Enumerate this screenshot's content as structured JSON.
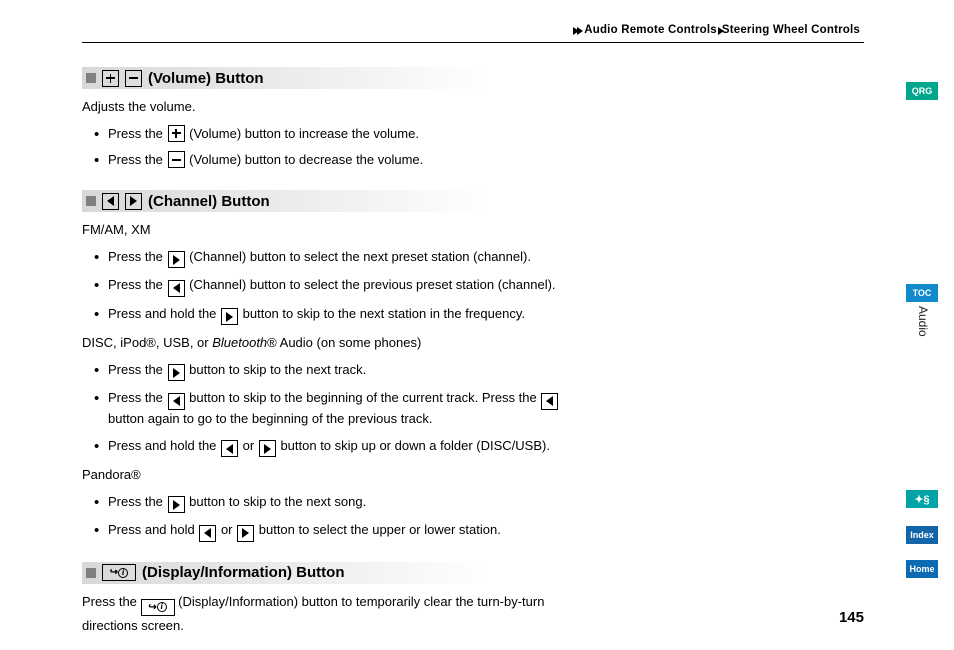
{
  "breadcrumb": {
    "a": "Audio Remote Controls",
    "b": "Steering Wheel Controls"
  },
  "sec1": {
    "title": "(Volume) Button",
    "intro": "Adjusts the volume.",
    "li1a": "Press the ",
    "li1b": " (Volume) button to increase the volume.",
    "li2a": "Press the ",
    "li2b": " (Volume) button to decrease the volume."
  },
  "sec2": {
    "title": "(Channel) Button",
    "sub1": "FM/AM, XM",
    "a1a": "Press the ",
    "a1b": " (Channel) button to select the next preset station (channel).",
    "a2a": "Press the ",
    "a2b": " (Channel) button to select the previous preset station (channel).",
    "a3a": "Press and hold the ",
    "a3b": " button to skip to the next station in the frequency.",
    "sub2a": "DISC, iPod®, USB, or ",
    "sub2b": "Bluetooth",
    "sub2c": "® Audio (on some phones)",
    "b1a": "Press the ",
    "b1b": " button to skip to the next track.",
    "b2a": "Press the ",
    "b2b": " button to skip to the beginning of the current track. Press the ",
    "b2c": " button again to go to the beginning of the previous track.",
    "b3a": "Press and hold the ",
    "b3b": " or ",
    "b3c": " button to skip up or down a folder (DISC/USB).",
    "sub3": "Pandora®",
    "c1a": "Press the ",
    "c1b": " button to skip to the next song.",
    "c2a": "Press and hold ",
    "c2b": " or ",
    "c2c": " button to select the upper or lower station."
  },
  "sec3": {
    "title": "(Display/Information) Button",
    "p1a": "Press the ",
    "p1b": " (Display/Information) button to temporarily clear the turn-by-turn directions screen."
  },
  "tabs": {
    "qrg": "QRG",
    "toc": "TOC",
    "audio": "Audio",
    "help": "✦§",
    "index": "Index",
    "home": "Home"
  },
  "page": "145"
}
